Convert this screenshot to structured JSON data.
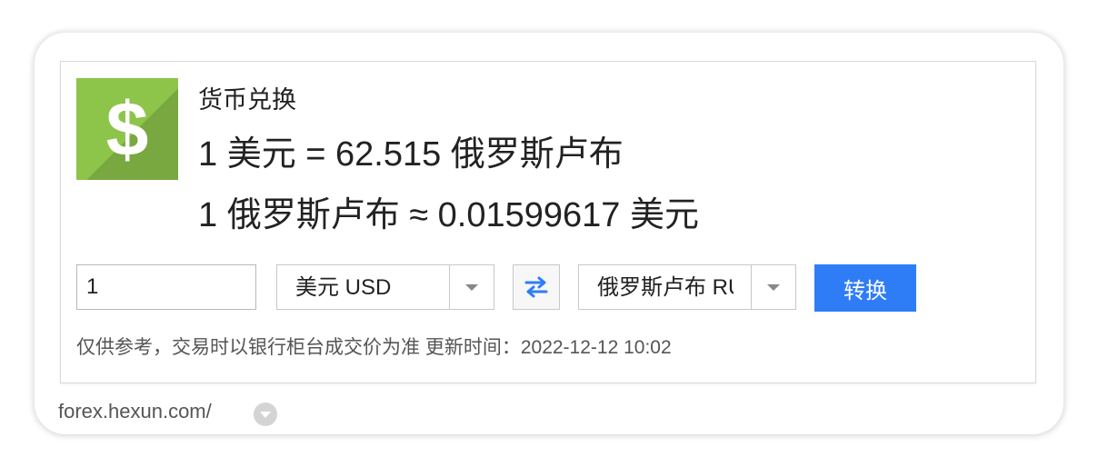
{
  "widget": {
    "title": "货币兑换",
    "logo_icon": "dollar-sign-icon",
    "logo_symbol": "$",
    "logo_color": "#8dc44a",
    "rate_line_1": "1 美元 = 62.515 俄罗斯卢布",
    "rate_line_2": "1 俄罗斯卢布 ≈ 0.01599617 美元"
  },
  "form": {
    "amount_value": "1",
    "from_currency": "美元 USD",
    "to_currency": "俄罗斯卢布 RUB",
    "swap_icon": "swap-arrows-icon",
    "convert_label": "转换",
    "button_color": "#2f7df6"
  },
  "footer": {
    "disclaimer": "仅供参考，交易时以银行柜台成交价为准 更新时间：2022-12-12 10:02"
  },
  "source": {
    "url": "forex.hexun.com/",
    "dropdown_icon": "chevron-down-circle-icon"
  }
}
